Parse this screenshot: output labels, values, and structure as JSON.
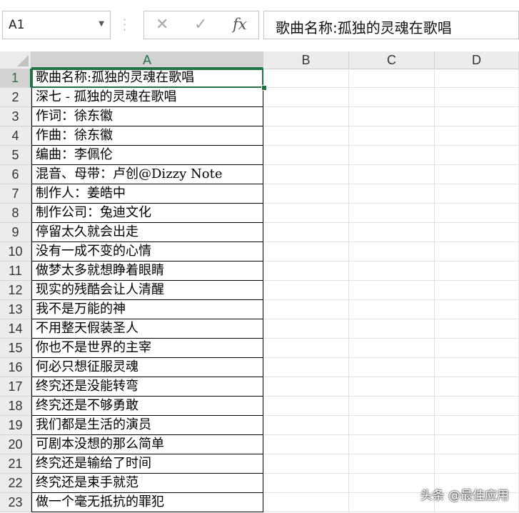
{
  "name_box": {
    "value": "A1"
  },
  "formula_bar": {
    "cancel_glyph": "✕",
    "enter_glyph": "✓",
    "fx_label": "fx",
    "content": "歌曲名称:孤独的灵魂在歌唱"
  },
  "columns": [
    "A",
    "B",
    "C",
    "D"
  ],
  "rows": [
    {
      "num": "1",
      "a": "歌曲名称:孤独的灵魂在歌唱"
    },
    {
      "num": "2",
      "a": "深七 - 孤独的灵魂在歌唱"
    },
    {
      "num": "3",
      "a": "作词：徐东徽"
    },
    {
      "num": "4",
      "a": "作曲：徐东徽"
    },
    {
      "num": "5",
      "a": "编曲：李佩伦"
    },
    {
      "num": "6",
      "a": "混音、母带：卢创@Dizzy Note"
    },
    {
      "num": "7",
      "a": "制作人：姜皓中"
    },
    {
      "num": "8",
      "a": "制作公司：兔迪文化"
    },
    {
      "num": "9",
      "a": "停留太久就会出走"
    },
    {
      "num": "10",
      "a": "没有一成不变的心情"
    },
    {
      "num": "11",
      "a": "做梦太多就想睁着眼睛"
    },
    {
      "num": "12",
      "a": "现实的残酷会让人清醒"
    },
    {
      "num": "13",
      "a": "我不是万能的神"
    },
    {
      "num": "14",
      "a": "不用整天假装圣人"
    },
    {
      "num": "15",
      "a": "你也不是世界的主宰"
    },
    {
      "num": "16",
      "a": "何必只想征服灵魂"
    },
    {
      "num": "17",
      "a": "终究还是没能转弯"
    },
    {
      "num": "18",
      "a": "终究还是不够勇敢"
    },
    {
      "num": "19",
      "a": "我们都是生活的演员"
    },
    {
      "num": "20",
      "a": "可剧本没想的那么简单"
    },
    {
      "num": "21",
      "a": "终究还是输给了时间"
    },
    {
      "num": "22",
      "a": "终究还是束手就范"
    },
    {
      "num": "23",
      "a": "做一个毫无抵抗的罪犯"
    }
  ],
  "selected_cell": "A1",
  "accent_color": "#217346",
  "watermark": "头条 @最佳应用"
}
